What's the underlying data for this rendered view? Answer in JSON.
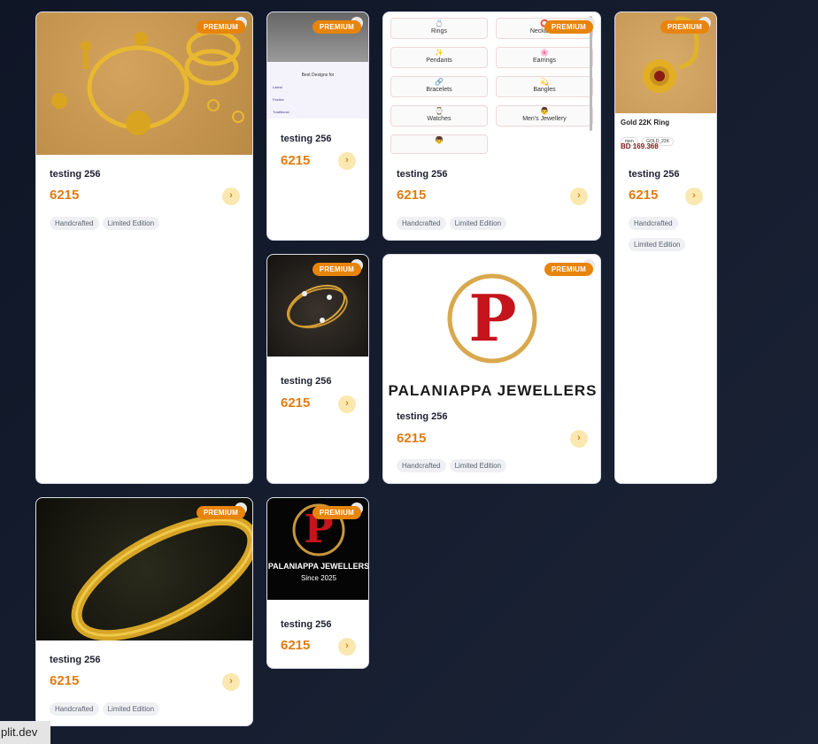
{
  "cards": [
    {
      "title": "testing 256",
      "price": "6215",
      "badge": "PREMIUM",
      "tags": [
        "Handcrafted",
        "Limited Edition"
      ]
    },
    {
      "title": "testing 256",
      "price": "6215",
      "badge": "PREMIUM",
      "inner": {
        "heading": "Best Designs for",
        "lines": [
          "Latest",
          "Festive",
          "Traditional"
        ]
      }
    },
    {
      "title": "testing 256",
      "price": "6215",
      "badge": "PREMIUM",
      "tags": [
        "Handcrafted",
        "Limited Edition"
      ],
      "categories": [
        "Rings",
        "Necklaces",
        "Pendants",
        "Earrings",
        "Bracelets",
        "Bangles",
        "Watches",
        "Men's Jewellery"
      ],
      "category_icons": [
        "💍",
        "⭕",
        "✨",
        "🌸",
        "🔗",
        "💫",
        "⌚",
        "👨"
      ]
    },
    {
      "title": "testing 256",
      "price": "6215",
      "badge": "PREMIUM",
      "tags": [
        "Handcrafted",
        "Limited Edition"
      ],
      "product": {
        "name": "Gold 22K Ring",
        "chips": [
          "men",
          "GOLD_22K"
        ],
        "price": "BD 169.368"
      }
    },
    {
      "title": "testing 256",
      "price": "6215",
      "badge": "PREMIUM"
    },
    {
      "title": "testing 256",
      "price": "6215",
      "badge": "PREMIUM",
      "tags": [
        "Handcrafted",
        "Limited Edition"
      ],
      "logo": {
        "letter": "P",
        "text": "PALANIAPPA JEWELLERS"
      }
    },
    {
      "title": "testing 256",
      "price": "6215",
      "badge": "PREMIUM",
      "tags": [
        "Handcrafted",
        "Limited Edition"
      ]
    },
    {
      "title": "testing 256",
      "price": "6215",
      "badge": "PREMIUM",
      "logo": {
        "letter": "P",
        "text": "PALANIAPPA JEWELLERS",
        "sub": "Since 2025"
      }
    }
  ],
  "footer": {
    "label": "plit.dev"
  },
  "arrow": "›"
}
